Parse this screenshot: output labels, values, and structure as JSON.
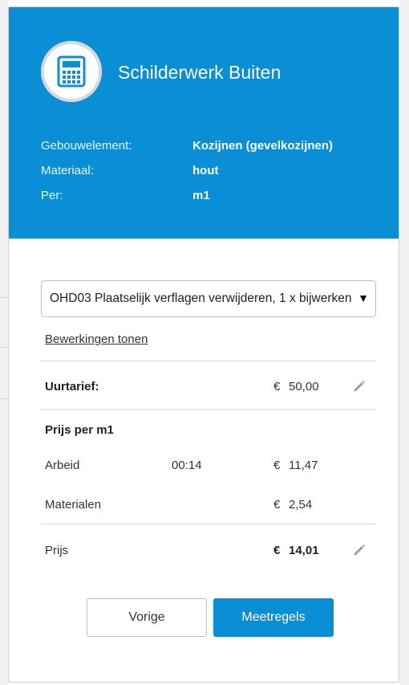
{
  "header": {
    "icon": "calculator-icon",
    "title": "Schilderwerk Buiten",
    "colors": {
      "header_bg": "#0a8fd6",
      "primary_button": "#0a8fd6"
    },
    "meta": [
      {
        "label": "Gebouwelement:",
        "value": "Kozijnen (gevelkozijnen)"
      },
      {
        "label": "Materiaal:",
        "value": "hout"
      },
      {
        "label": "Per:",
        "value": "m1"
      }
    ]
  },
  "operation_select": {
    "selected": "OHD03 Plaatselijk verflagen verwijderen, 1 x bijwerken"
  },
  "show_operations_link": "Bewerkingen tonen",
  "hourly_rate": {
    "label": "Uurtarief:",
    "currency": "€",
    "amount": "50,00"
  },
  "price_section": {
    "heading": "Prijs per m1",
    "rows": [
      {
        "label": "Arbeid",
        "time": "00:14",
        "currency": "€",
        "amount": "11,47"
      },
      {
        "label": "Materialen",
        "time": "",
        "currency": "€",
        "amount": "2,54"
      }
    ],
    "total": {
      "label": "Prijs",
      "currency": "€",
      "amount": "14,01"
    }
  },
  "buttons": {
    "previous": "Vorige",
    "next": "Meetregels"
  }
}
